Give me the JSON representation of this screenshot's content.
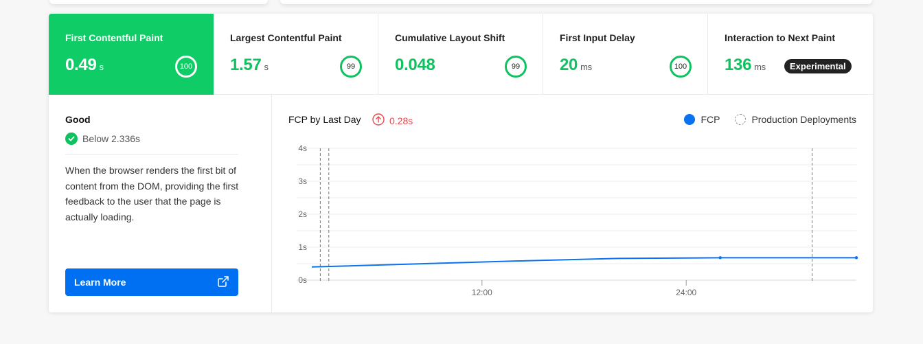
{
  "metrics": [
    {
      "title": "First Contentful Paint",
      "value": "0.49",
      "unit": "s",
      "score": "100",
      "active": true
    },
    {
      "title": "Largest Contentful Paint",
      "value": "1.57",
      "unit": "s",
      "score": "99"
    },
    {
      "title": "Cumulative Layout Shift",
      "value": "0.048",
      "unit": "",
      "score": "99"
    },
    {
      "title": "First Input Delay",
      "value": "20",
      "unit": "ms",
      "score": "100"
    },
    {
      "title": "Interaction to Next Paint",
      "value": "136",
      "unit": "ms",
      "badge": "Experimental"
    }
  ],
  "details": {
    "status_title": "Good",
    "threshold": "Below 2.336s",
    "description": "When the browser renders the first bit of content from the DOM, providing the first feedback to the user that the page is actually loading.",
    "button_label": "Learn More",
    "status_color": "#10c15f",
    "button_color": "#0070f3"
  },
  "chart": {
    "title": "FCP by Last Day",
    "delta": "0.28s",
    "delta_color": "#e5484d",
    "legend_fcp": "FCP",
    "legend_deploy": "Production Deployments",
    "line_color": "#0a72ef"
  },
  "chart_data": {
    "type": "line",
    "xlabel": "",
    "ylabel": "",
    "ylim": [
      0,
      4
    ],
    "y_ticks": [
      "0s",
      "1s",
      "2s",
      "3s",
      "4s"
    ],
    "x_ticks": [
      {
        "hour": 12,
        "label": "12:00"
      },
      {
        "hour": 24,
        "label": "24:00"
      }
    ],
    "xlim": [
      2,
      34
    ],
    "series": [
      {
        "name": "FCP",
        "x": [
          2,
          14,
          20,
          26,
          34
        ],
        "y": [
          0.4,
          0.58,
          0.66,
          0.68,
          0.68
        ],
        "markers_at": [
          26,
          34
        ]
      }
    ],
    "deployments": [
      2.5,
      3,
      31.4
    ],
    "grid": true,
    "legend": "top-right"
  }
}
